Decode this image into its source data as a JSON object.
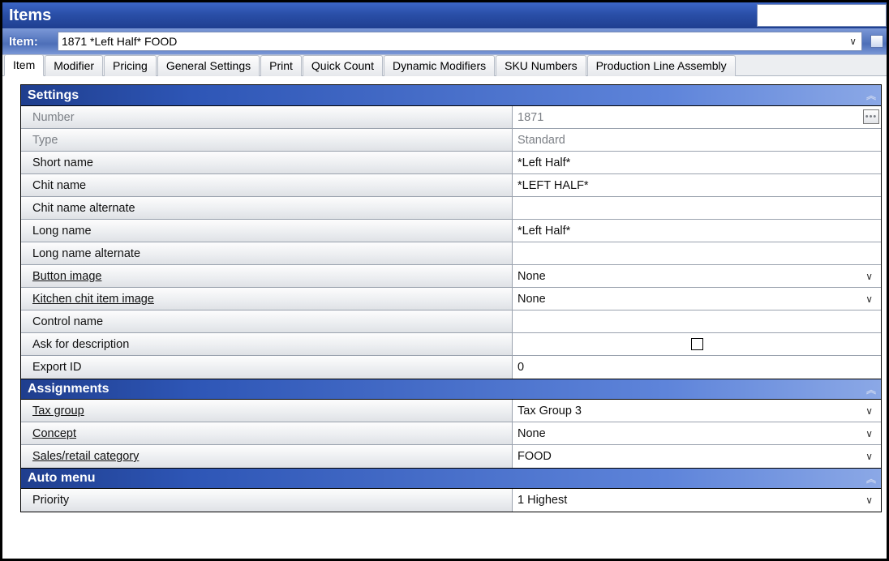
{
  "window": {
    "title": "Items"
  },
  "selector": {
    "label": "Item:",
    "value": "1871 *Left Half* FOOD"
  },
  "tabs": [
    {
      "label": "Item",
      "active": true
    },
    {
      "label": "Modifier"
    },
    {
      "label": "Pricing"
    },
    {
      "label": "General Settings"
    },
    {
      "label": "Print"
    },
    {
      "label": "Quick Count"
    },
    {
      "label": "Dynamic Modifiers"
    },
    {
      "label": "SKU Numbers"
    },
    {
      "label": "Production Line Assembly"
    }
  ],
  "sections": {
    "settings": {
      "title": "Settings",
      "rows": {
        "number": {
          "label": "Number",
          "value": "1871",
          "disabled": true,
          "dots": true
        },
        "type": {
          "label": "Type",
          "value": "Standard",
          "disabled": true
        },
        "short_name": {
          "label": "Short name",
          "value": "*Left Half*"
        },
        "chit_name": {
          "label": "Chit name",
          "value": "*LEFT HALF*"
        },
        "chit_name_alt": {
          "label": "Chit name alternate",
          "value": ""
        },
        "long_name": {
          "label": "Long name",
          "value": "*Left Half*"
        },
        "long_name_alt": {
          "label": "Long name alternate",
          "value": ""
        },
        "button_image": {
          "label": "Button image",
          "value": "None",
          "link": true,
          "dropdown": true
        },
        "kitchen_chit_img": {
          "label": "Kitchen chit item image",
          "value": "None",
          "link": true,
          "dropdown": true
        },
        "control_name": {
          "label": "Control name",
          "value": ""
        },
        "ask_for_description": {
          "label": "Ask for description",
          "checkbox": true,
          "checked": false
        },
        "export_id": {
          "label": "Export ID",
          "value": "0"
        }
      }
    },
    "assignments": {
      "title": "Assignments",
      "rows": {
        "tax_group": {
          "label": "Tax group",
          "value": "Tax Group 3",
          "link": true,
          "dropdown": true
        },
        "concept": {
          "label": "Concept",
          "value": "None",
          "link": true,
          "dropdown": true
        },
        "sales_retail": {
          "label": "Sales/retail category",
          "value": "FOOD",
          "link": true,
          "dropdown": true
        }
      }
    },
    "auto_menu": {
      "title": "Auto menu",
      "rows": {
        "priority": {
          "label": "Priority",
          "value": "1 Highest",
          "dropdown": true
        }
      }
    }
  }
}
